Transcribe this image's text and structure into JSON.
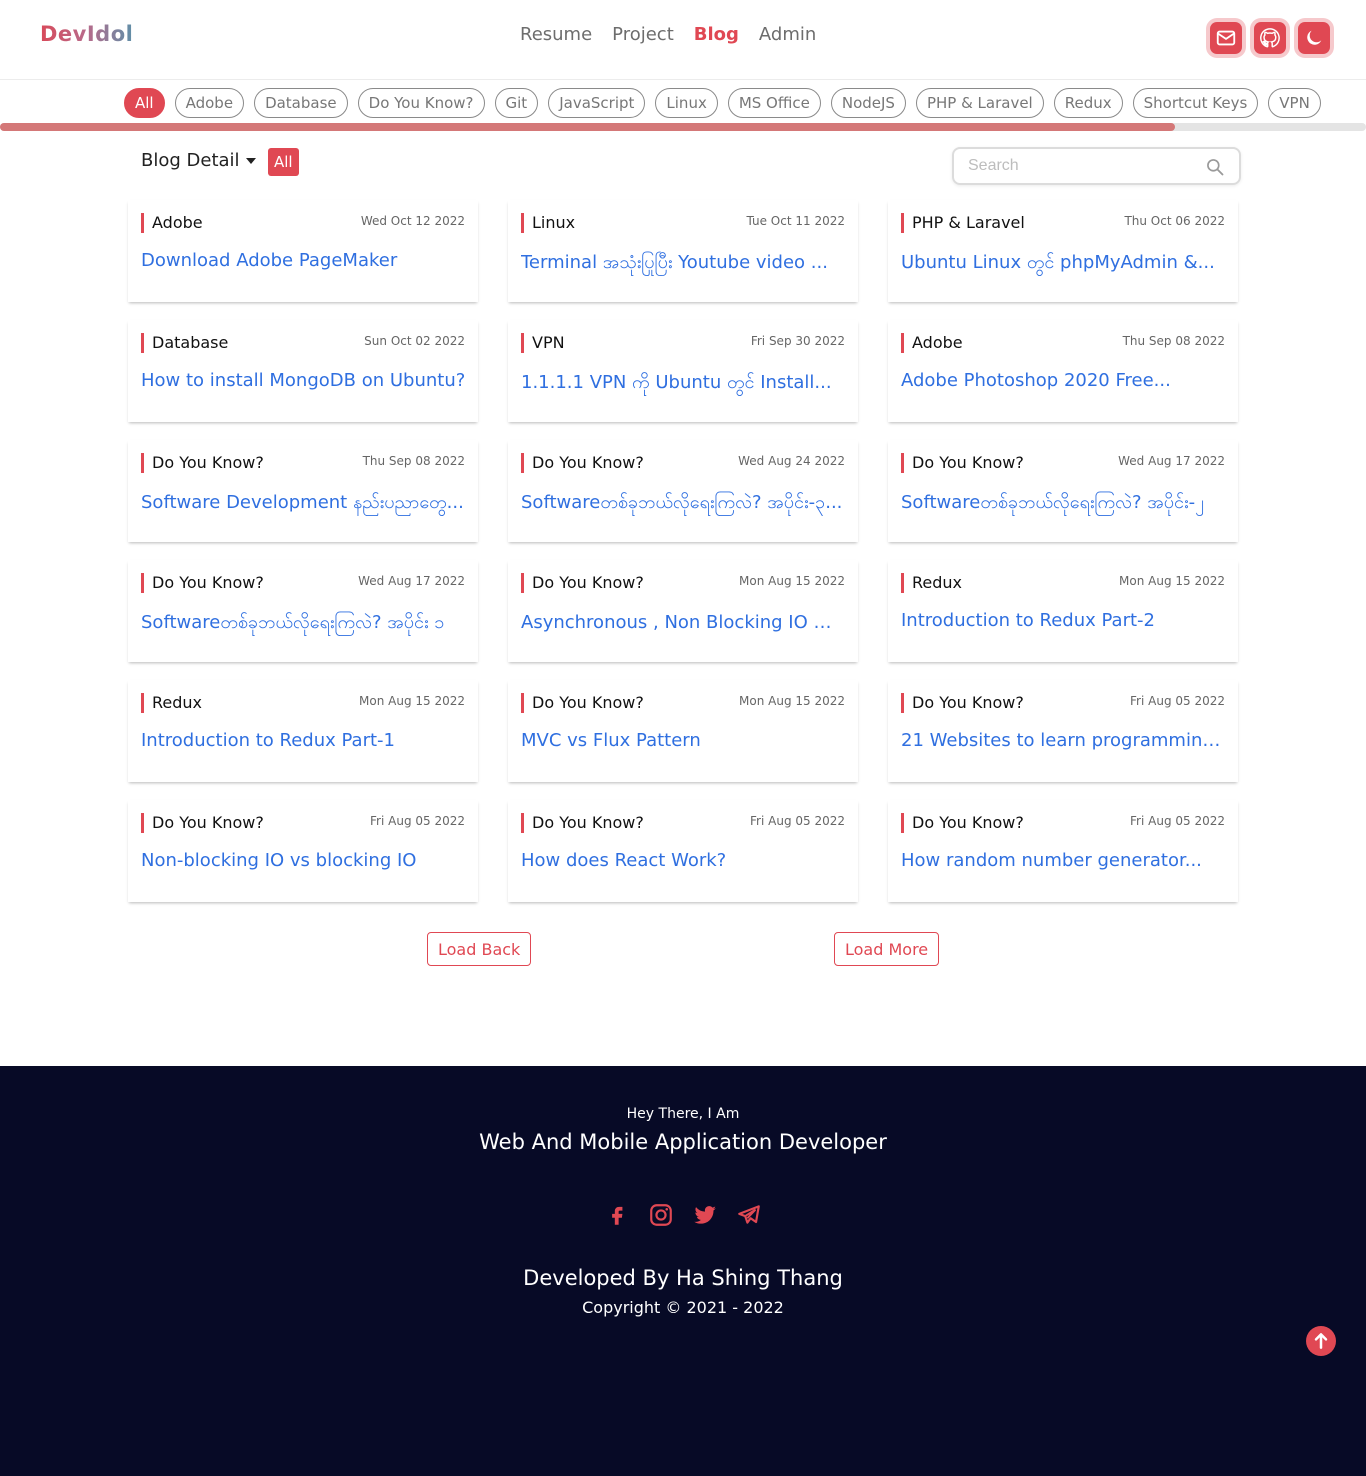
{
  "header": {
    "logo": "DevIdol",
    "nav": [
      {
        "label": "Resume",
        "active": false
      },
      {
        "label": "Project",
        "active": false
      },
      {
        "label": "Blog",
        "active": true
      },
      {
        "label": "Admin",
        "active": false
      }
    ],
    "icons": [
      "mail-icon",
      "github-icon",
      "moon-icon"
    ]
  },
  "categories": [
    "All",
    "Adobe",
    "Database",
    "Do You Know?",
    "Git",
    "JavaScript",
    "Linux",
    "MS Office",
    "NodeJS",
    "PHP & Laravel",
    "Redux",
    "Shortcut Keys",
    "VPN"
  ],
  "active_category": "All",
  "toolbar": {
    "blog_detail_label": "Blog Detail",
    "filter_badge": "All",
    "search_placeholder": "Search"
  },
  "posts": [
    {
      "category": "Adobe",
      "date": "Wed Oct 12 2022",
      "title": "Download Adobe PageMaker"
    },
    {
      "category": "Linux",
      "date": "Tue Oct 11 2022",
      "title": "Terminal အသုံးပြုပြီး Youtube video ..."
    },
    {
      "category": "PHP & Laravel",
      "date": "Thu Oct 06 2022",
      "title": "Ubuntu Linux တွင် phpMyAdmin &..."
    },
    {
      "category": "Database",
      "date": "Sun Oct 02 2022",
      "title": "How to install MongoDB on Ubuntu?"
    },
    {
      "category": "VPN",
      "date": "Fri Sep 30 2022",
      "title": "1.1.1.1 VPN ကို Ubuntu တွင် Install..."
    },
    {
      "category": "Adobe",
      "date": "Thu Sep 08 2022",
      "title": "Adobe Photoshop 2020 Free..."
    },
    {
      "category": "Do You Know?",
      "date": "Thu Sep 08 2022",
      "title": "Software Development နည်းပညာတွေ..."
    },
    {
      "category": "Do You Know?",
      "date": "Wed Aug 24 2022",
      "title": "Softwareတစ်ခုဘယ်လိုရေးကြလဲ? အပိုင်း-၃..."
    },
    {
      "category": "Do You Know?",
      "date": "Wed Aug 17 2022",
      "title": "Softwareတစ်ခုဘယ်လိုရေးကြလဲ? အပိုင်း-၂"
    },
    {
      "category": "Do You Know?",
      "date": "Wed Aug 17 2022",
      "title": "Softwareတစ်ခုဘယ်လိုရေးကြလဲ? အပိုင်း ၁"
    },
    {
      "category": "Do You Know?",
      "date": "Mon Aug 15 2022",
      "title": "Asynchronous , Non Blocking IO က..."
    },
    {
      "category": "Redux",
      "date": "Mon Aug 15 2022",
      "title": "Introduction to Redux Part-2"
    },
    {
      "category": "Redux",
      "date": "Mon Aug 15 2022",
      "title": "Introduction to Redux Part-1"
    },
    {
      "category": "Do You Know?",
      "date": "Mon Aug 15 2022",
      "title": "MVC vs Flux Pattern"
    },
    {
      "category": "Do You Know?",
      "date": "Fri Aug 05 2022",
      "title": "21 Websites to learn programming..."
    },
    {
      "category": "Do You Know?",
      "date": "Fri Aug 05 2022",
      "title": "Non-blocking IO vs blocking IO"
    },
    {
      "category": "Do You Know?",
      "date": "Fri Aug 05 2022",
      "title": "How does React Work?"
    },
    {
      "category": "Do You Know?",
      "date": "Fri Aug 05 2022",
      "title": "How random number generator..."
    }
  ],
  "pagination": {
    "back_label": "Load Back",
    "more_label": "Load More"
  },
  "footer": {
    "greeting": "Hey There, I Am",
    "role": "Web And Mobile Application Developer",
    "social": [
      "facebook-icon",
      "instagram-icon",
      "twitter-icon",
      "telegram-icon"
    ],
    "developer": "Developed By Ha Shing Thang",
    "copyright": "Copyright © 2021 - 2022"
  },
  "scroll_progress": 0.86,
  "colors": {
    "accent": "#e04853",
    "link": "#2f6fe0",
    "footer_bg": "#070a26"
  }
}
